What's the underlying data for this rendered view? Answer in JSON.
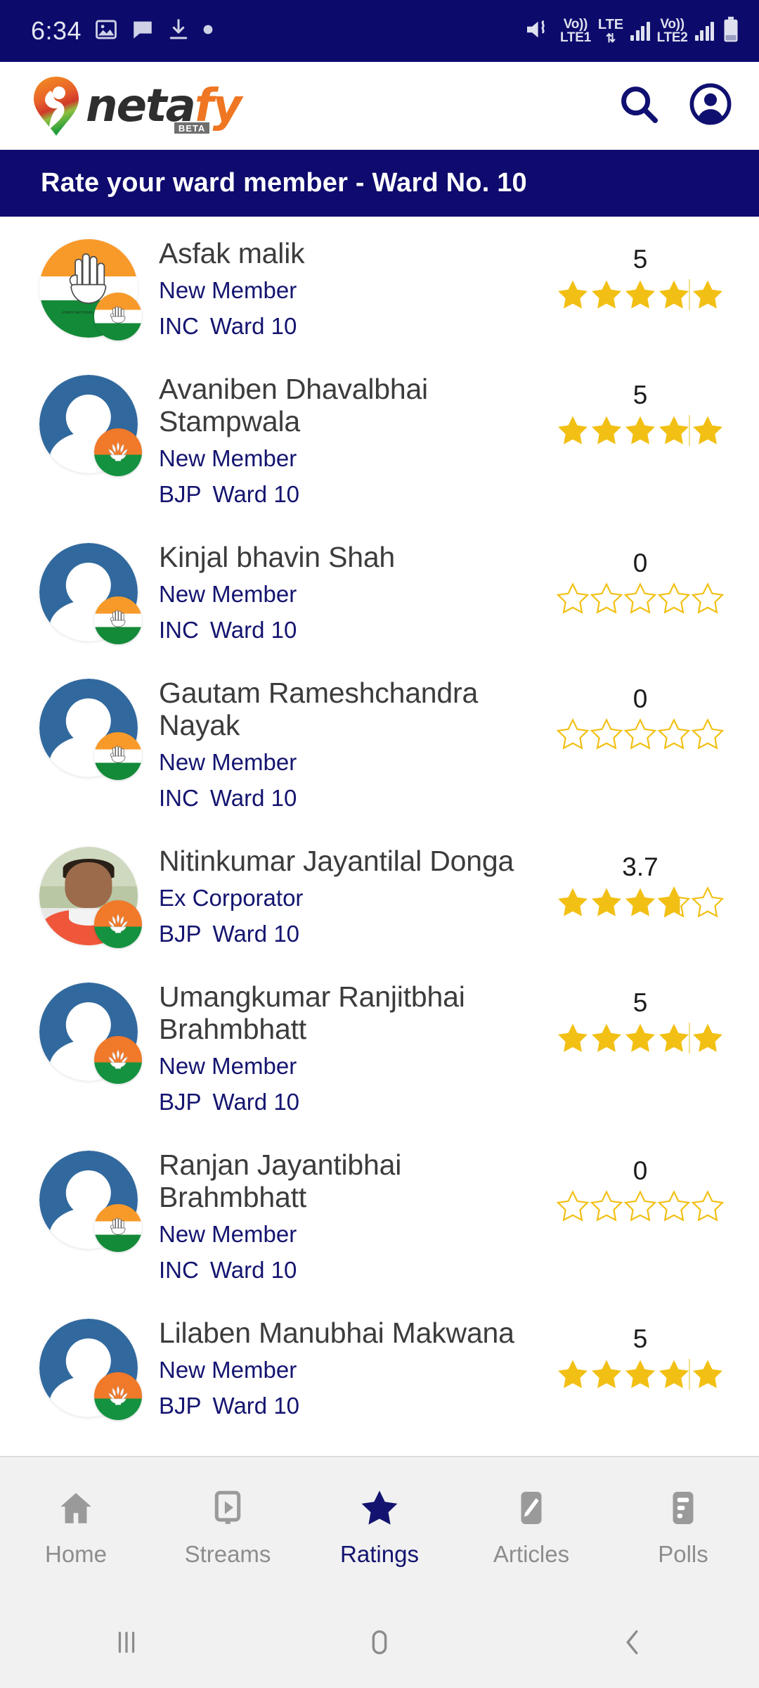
{
  "status_bar": {
    "time": "6:34",
    "left_icons": [
      "image-icon",
      "chat-bubble-icon",
      "download-icon",
      "dot-icon"
    ],
    "mute_icon": "mute-icon",
    "sim1": {
      "volte": "Vo))",
      "network": "LTE1"
    },
    "data_indicator": {
      "label": "LTE",
      "arrows": "down-up-arrows-icon"
    },
    "sim2": {
      "volte": "Vo))",
      "network": "LTE2"
    },
    "battery_icon": "battery-icon"
  },
  "app_bar": {
    "logo_primary": "neta",
    "logo_accent": "fy",
    "logo_badge": "BETA",
    "logo_mark": "location-pin-person-icon",
    "search_icon": "search-icon",
    "account_icon": "account-circle-icon"
  },
  "banner": {
    "title": "Rate your ward member  -  Ward No. 10"
  },
  "members": [
    {
      "name": "Asfak malik",
      "role": "New Member",
      "party": "INC",
      "ward": "Ward 10",
      "rating": "5",
      "rating_value": 5,
      "avatar_type": "inc-symbol",
      "badge": "inc"
    },
    {
      "name": "Avaniben Dhavalbhai Stampwala",
      "role": "New Member",
      "party": "BJP",
      "ward": "Ward 10",
      "rating": "5",
      "rating_value": 5,
      "avatar_type": "person-placeholder",
      "badge": "bjp"
    },
    {
      "name": "Kinjal bhavin Shah",
      "role": "New Member",
      "party": "INC",
      "ward": "Ward 10",
      "rating": "0",
      "rating_value": 0,
      "avatar_type": "person-placeholder",
      "badge": "inc"
    },
    {
      "name": "Gautam Rameshchandra Nayak",
      "role": "New Member",
      "party": "INC",
      "ward": "Ward 10",
      "rating": "0",
      "rating_value": 0,
      "avatar_type": "person-placeholder",
      "badge": "inc"
    },
    {
      "name": "Nitinkumar Jayantilal Donga",
      "role": "Ex Corporator",
      "party": "BJP",
      "ward": "Ward 10",
      "rating": "3.7",
      "rating_value": 3.7,
      "avatar_type": "photo",
      "badge": "bjp"
    },
    {
      "name": "Umangkumar Ranjitbhai Brahmbhatt",
      "role": "New Member",
      "party": "BJP",
      "ward": "Ward 10",
      "rating": "5",
      "rating_value": 5,
      "avatar_type": "person-placeholder",
      "badge": "bjp"
    },
    {
      "name": "Ranjan Jayantibhai Brahmbhatt",
      "role": "New Member",
      "party": "INC",
      "ward": "Ward 10",
      "rating": "0",
      "rating_value": 0,
      "avatar_type": "person-placeholder",
      "badge": "inc"
    },
    {
      "name": "Lilaben Manubhai Makwana",
      "role": "New Member",
      "party": "BJP",
      "ward": "Ward 10",
      "rating": "5",
      "rating_value": 5,
      "avatar_type": "person-placeholder",
      "badge": "bjp"
    }
  ],
  "bottom_nav": {
    "active": "Ratings",
    "items": [
      {
        "label": "Home",
        "icon": "home-icon"
      },
      {
        "label": "Streams",
        "icon": "video-play-icon"
      },
      {
        "label": "Ratings",
        "icon": "star-icon"
      },
      {
        "label": "Articles",
        "icon": "pencil-icon"
      },
      {
        "label": "Polls",
        "icon": "poll-bars-icon"
      }
    ]
  },
  "system_nav": {
    "recents_icon": "recents-icon",
    "home_icon": "home-pill-icon",
    "back_icon": "back-chevron-icon"
  },
  "colors": {
    "navy": "#0e0a6e",
    "star_gold": "#f2c014",
    "accent_orange": "#ef7622",
    "avatar_blue": "#31699e",
    "text_dark": "#3c3c3c"
  }
}
